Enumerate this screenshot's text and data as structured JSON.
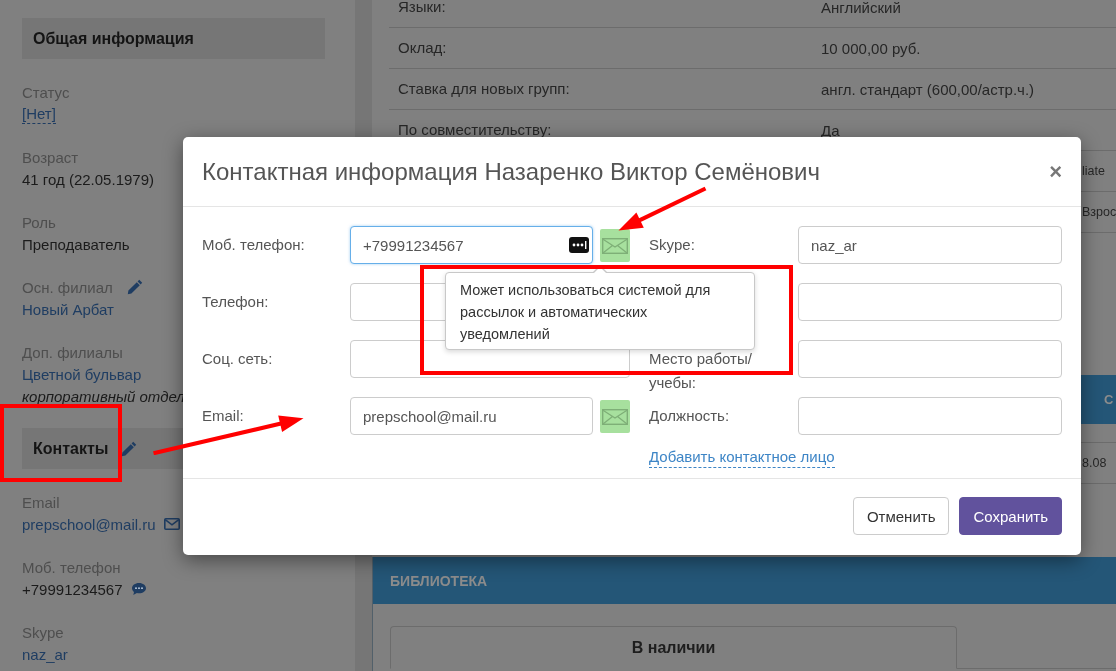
{
  "sidebar": {
    "sections": [
      {
        "title": "Общая информация",
        "editable": false,
        "fields": [
          {
            "label": "Статус",
            "editable": false,
            "values": [
              {
                "kind": "dashed-link",
                "text": "[Нет]"
              }
            ]
          },
          {
            "label": "Возраст",
            "editable": false,
            "values": [
              {
                "kind": "text",
                "text": "41 год (22.05.1979)"
              }
            ]
          },
          {
            "label": "Роль",
            "editable": false,
            "values": [
              {
                "kind": "text",
                "text": "Преподаватель"
              }
            ]
          },
          {
            "label": "Осн. филиал",
            "editable": true,
            "values": [
              {
                "kind": "link",
                "text": "Новый Арбат"
              }
            ]
          },
          {
            "label": "Доп. филиалы",
            "editable": false,
            "values": [
              {
                "kind": "link",
                "text": "Цветной бульвар"
              },
              {
                "kind": "note",
                "text": "корпоративный отдел"
              }
            ]
          }
        ]
      },
      {
        "title": "Контакты",
        "editable": true,
        "fields": [
          {
            "label": "Email",
            "editable": false,
            "values": [
              {
                "kind": "email",
                "text": "prepschool@mail.ru"
              }
            ]
          },
          {
            "label": "Моб. телефон",
            "editable": false,
            "values": [
              {
                "kind": "phone",
                "text": "+79991234567"
              }
            ]
          },
          {
            "label": "Skype",
            "editable": false,
            "values": [
              {
                "kind": "link",
                "text": "naz_ar"
              }
            ]
          }
        ]
      }
    ]
  },
  "details": {
    "rows": [
      {
        "label": "Языки:",
        "value": "Английский"
      },
      {
        "label": "Оклад:",
        "value": "10 000,00 руб."
      },
      {
        "label": "Ставка для новых групп:",
        "value": "англ. стандарт (600,00/астр.ч.)"
      },
      {
        "label": "По совместительству:",
        "value": "Да"
      }
    ],
    "partly_hidden": [
      {
        "kind": "row",
        "text": "liate"
      },
      {
        "kind": "row",
        "text": "Взрос"
      },
      {
        "kind": "bar",
        "text": "С"
      },
      {
        "kind": "row",
        "text": "8.08"
      }
    ]
  },
  "library": {
    "title": "БИБЛИОТЕКА",
    "tabs": [
      {
        "label": "В наличии",
        "selected": true
      }
    ]
  },
  "dialog": {
    "title": "Контактная информация Назаренко Виктор Семёнович",
    "close": "×",
    "left_fields": [
      {
        "label": "Моб. телефон:",
        "value": "+79991234567",
        "focused": true,
        "mail_button": true
      },
      {
        "label": "Телефон:",
        "focused": false,
        "mail_button": false
      },
      {
        "label": "Соц. сеть:",
        "focused": false,
        "mail_button": false
      },
      {
        "label": "Email:",
        "value": "prepschool@mail.ru",
        "focused": false,
        "mail_button": true
      }
    ],
    "right_fields": [
      {
        "label": "Skype:",
        "value": "naz_ar",
        "focused": false
      },
      {
        "focused": false
      },
      {
        "label": "Место работы/ учебы:",
        "focused": false
      },
      {
        "label": "Должность:",
        "focused": false
      }
    ],
    "add_link": "Добавить контактное лицо",
    "tooltip": "Может использоваться системой для рассылок и автоматических уведомлений",
    "buttons": [
      {
        "label": "Отменить",
        "kind": "secondary"
      },
      {
        "label": "Сохранить",
        "kind": "primary"
      }
    ]
  },
  "annotations": [
    {
      "kind": "frame"
    },
    {
      "kind": "arrow"
    },
    {
      "kind": "arrow"
    },
    {
      "kind": "frame"
    }
  ]
}
